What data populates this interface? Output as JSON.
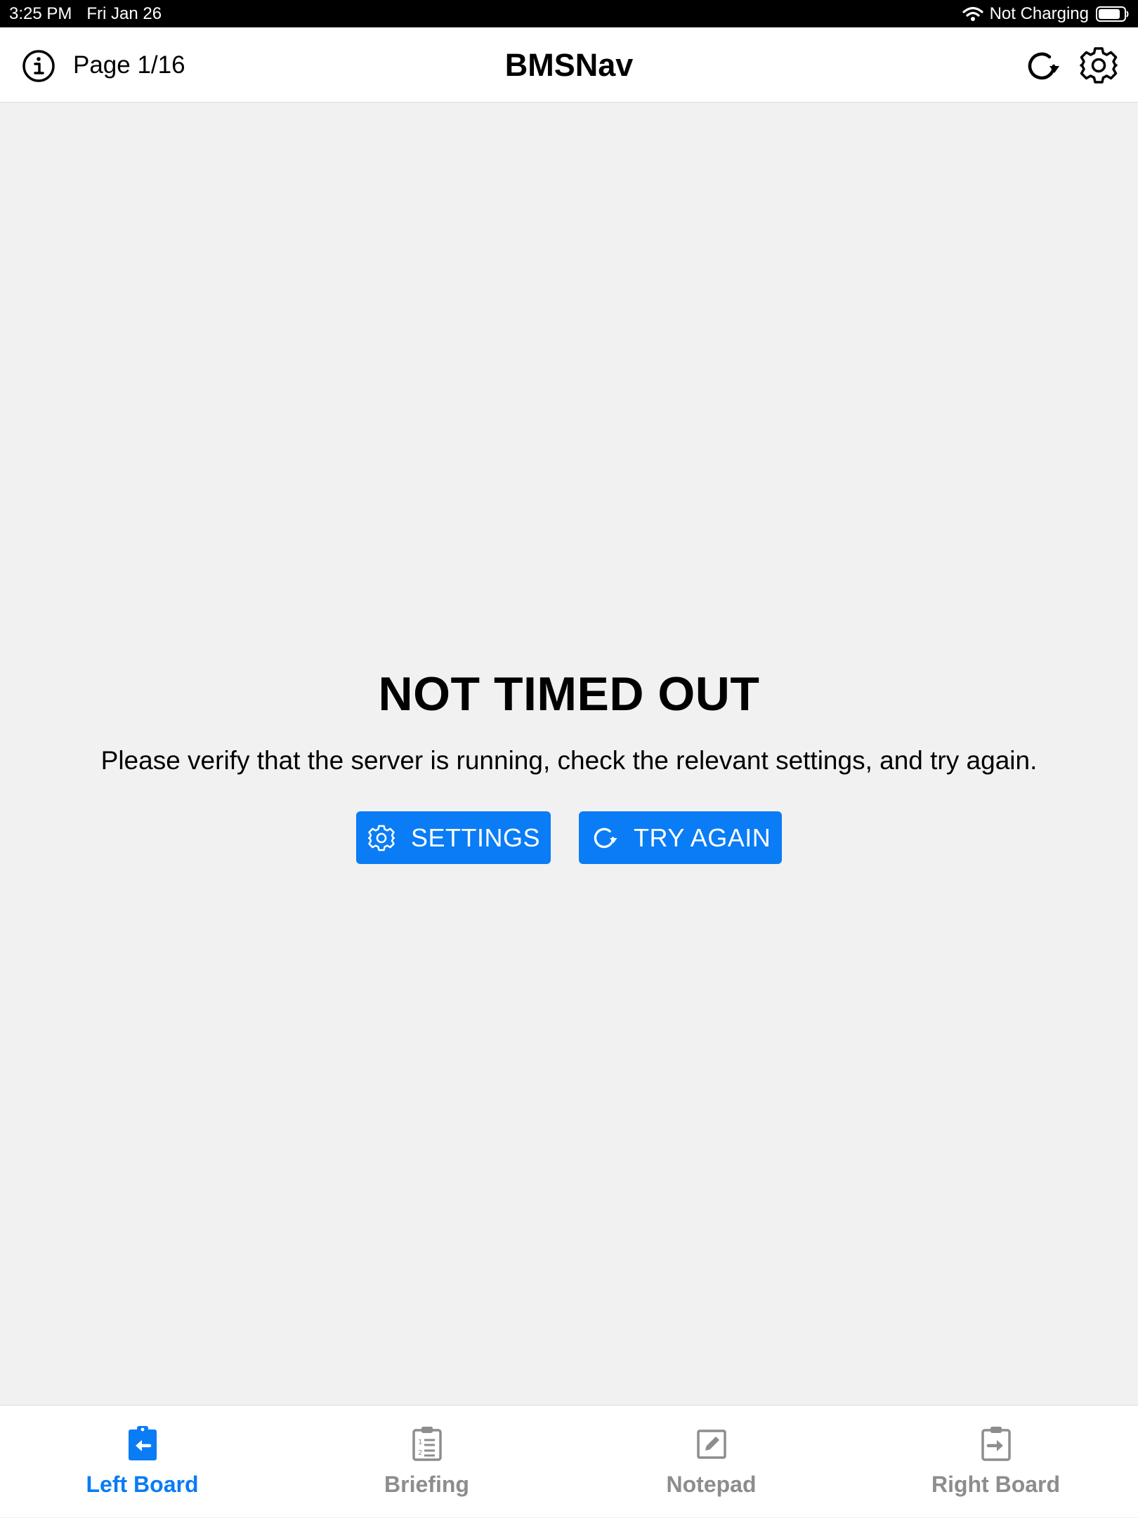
{
  "status_bar": {
    "time": "3:25 PM",
    "date": "Fri Jan 26",
    "charging_status": "Not Charging",
    "icons": [
      "wifi-icon",
      "battery-icon"
    ]
  },
  "nav": {
    "title": "BMSNav",
    "page_indicator": "Page 1/16",
    "icons": [
      "info-icon",
      "refresh-icon",
      "gear-icon"
    ]
  },
  "error": {
    "title": "NOT TIMED OUT",
    "message": "Please verify that the server is running, check the relevant settings, and try again.",
    "settings_label": "SETTINGS",
    "retry_label": "TRY AGAIN"
  },
  "tabs": [
    {
      "label": "Left Board",
      "icon": "clipboard-left-icon",
      "active": true
    },
    {
      "label": "Briefing",
      "icon": "clipboard-list-icon",
      "active": false
    },
    {
      "label": "Notepad",
      "icon": "notepad-icon",
      "active": false
    },
    {
      "label": "Right Board",
      "icon": "clipboard-right-icon",
      "active": false
    }
  ],
  "colors": {
    "accent": "#0a7cf5",
    "inactive": "#8d8d8d",
    "background": "#f1f1f1",
    "bar": "#ffffff"
  }
}
